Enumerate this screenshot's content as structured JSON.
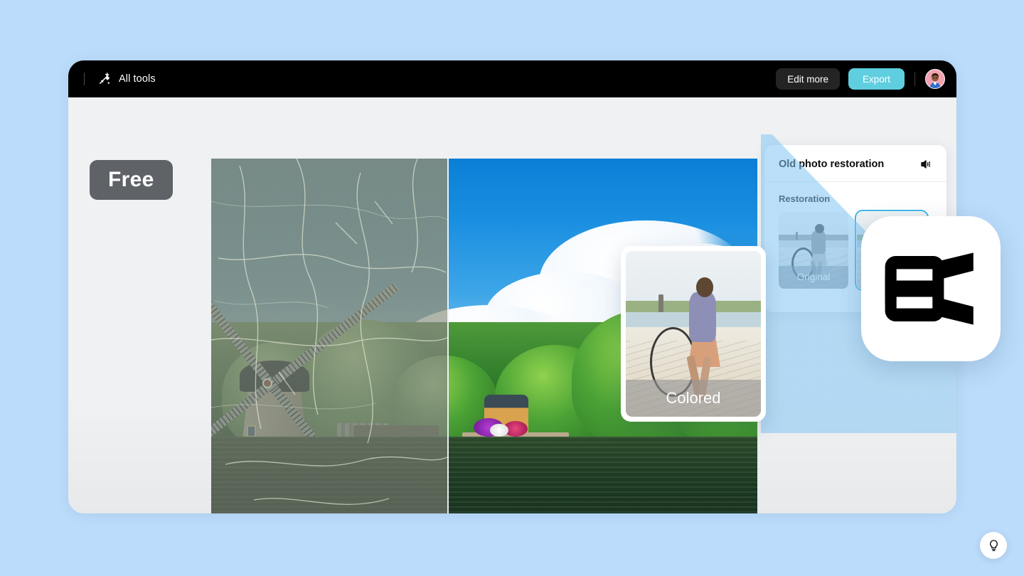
{
  "background_color": "#bcdcfb",
  "topbar": {
    "tools_icon": "magic-wand-icon",
    "tools_label": "All tools",
    "edit_more_label": "Edit more",
    "export_label": "Export",
    "export_color": "#5fcfe0",
    "avatar": "user-avatar"
  },
  "badge": {
    "label": "Free",
    "color": "#5f6368"
  },
  "panel": {
    "title": "Old photo restoration",
    "sound_icon": "speaker-icon",
    "section_label": "Restoration",
    "thumbnails": [
      {
        "label": "Original",
        "selected": false,
        "name": "thumb-original"
      },
      {
        "label": "",
        "selected": true,
        "name": "thumb-colored"
      }
    ],
    "selection_color": "#3fb6e8"
  },
  "colored_card": {
    "label": "Colored"
  },
  "brand": {
    "logo_name": "capcut-logo"
  },
  "help": {
    "icon": "lightbulb-icon"
  },
  "photo": {
    "left_state": "damaged-faded-original",
    "right_state": "restored-vivid",
    "subject": "windmill-landscape"
  }
}
